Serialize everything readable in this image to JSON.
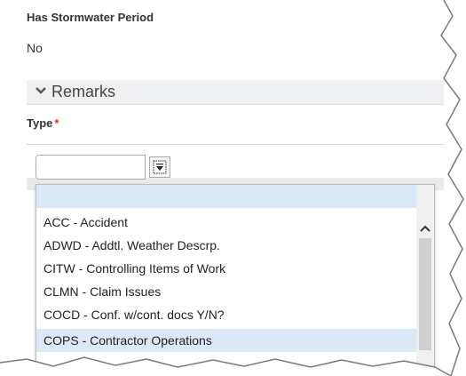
{
  "fields": {
    "stormwater_label": "Has Stormwater Period",
    "stormwater_value": "No",
    "type_label": "Type",
    "type_required_marker": "*"
  },
  "remarks": {
    "title": "Remarks",
    "expanded": true
  },
  "type_combo": {
    "value": "",
    "open": true
  },
  "options": [
    {
      "label": "",
      "highlighted": true
    },
    {
      "label": "ACC - Accident",
      "highlighted": false
    },
    {
      "label": "ADWD - Addtl. Weather Descrp.",
      "highlighted": false
    },
    {
      "label": "CITW - Controlling Items of Work",
      "highlighted": false
    },
    {
      "label": "CLMN - Claim Issues",
      "highlighted": false
    },
    {
      "label": "COCD - Conf. w/cont. docs Y/N?",
      "highlighted": false
    },
    {
      "label": "COPS - Contractor Operations",
      "highlighted": true
    }
  ],
  "colors": {
    "highlight": "#dbe9f7",
    "required": "#d9341f",
    "section_bg": "#eef0f2"
  }
}
